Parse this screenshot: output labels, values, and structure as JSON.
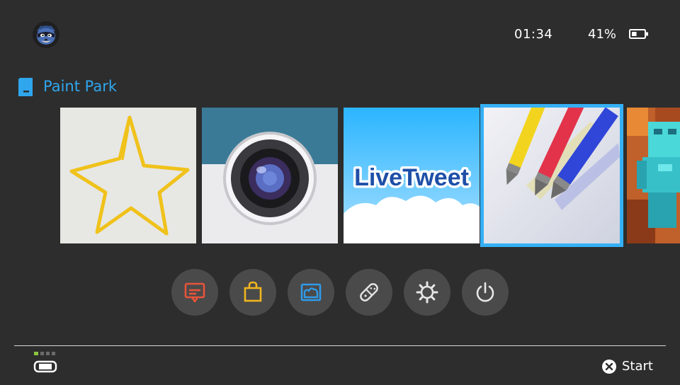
{
  "status_bar": {
    "time": "01:34",
    "battery_percent": "41%",
    "battery_level": 0.41
  },
  "selected_title": "Paint Park",
  "tiles": [
    {
      "name": "star-drawing",
      "icon": "yellow-star-drawing"
    },
    {
      "name": "camera",
      "icon": "camera-lens"
    },
    {
      "name": "livetweet",
      "label": "LiveTweet"
    },
    {
      "name": "paint-park",
      "icon": "crayons",
      "selected": true
    },
    {
      "name": "blocky-game",
      "icon": "diamond-armor-character"
    }
  ],
  "menu": [
    {
      "name": "news",
      "icon": "news-icon",
      "color": "#e8543a"
    },
    {
      "name": "shop",
      "icon": "shopping-bag-icon",
      "color": "#f0b51f"
    },
    {
      "name": "album",
      "icon": "album-icon",
      "color": "#2f9be8"
    },
    {
      "name": "controllers",
      "icon": "controller-icon",
      "color": "#e6e6e6"
    },
    {
      "name": "settings",
      "icon": "gear-icon",
      "color": "#e6e6e6"
    },
    {
      "name": "power",
      "icon": "power-icon",
      "color": "#e6e6e6"
    }
  ],
  "footer": {
    "start_label": "Start",
    "controller_indicator": {
      "active_player": 1,
      "total": 4
    }
  },
  "colors": {
    "background": "#2d2d2d",
    "accent": "#2fa6ee",
    "selection": "#35b0f5"
  }
}
